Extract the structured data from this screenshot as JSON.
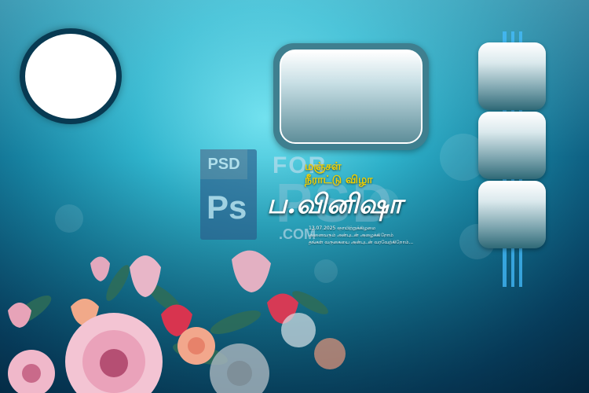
{
  "invitation": {
    "event_title_line1": "மஞ்சள்",
    "event_title_line2": "நீராட்டு விழா",
    "name": "ப.வினிஷா",
    "details": [
      "13.07.2025 ஞாயிற்றுக்கிழமை",
      "அனைவரும் அன்புடன் அழைக்கிறோம்",
      "தங்கள் வருகையை அன்புடன் வரவேற்கிறோம்..."
    ]
  },
  "watermark": {
    "psd_tab": "PSD",
    "ps_logo": "Ps",
    "for_text": "FOR",
    "psd_big": "PSD",
    "com_text": ".COM"
  },
  "colors": {
    "title_yellow": "#f3d100",
    "name_white": "#ffffff",
    "accent_bar_blue": "#46beff"
  }
}
